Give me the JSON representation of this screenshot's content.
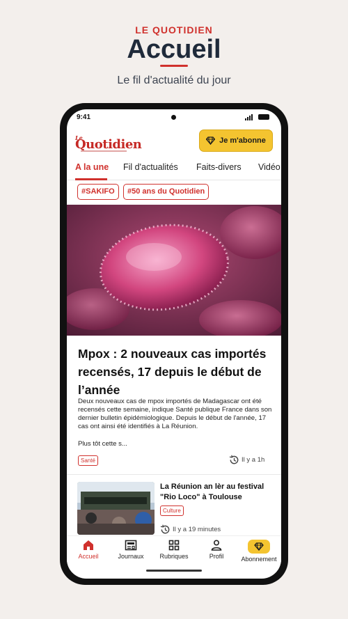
{
  "hero": {
    "brand": "LE QUOTIDIEN",
    "title": "Accueil",
    "subtitle": "Le fil d'actualité du jour"
  },
  "status_bar": {
    "time": "9:41"
  },
  "header": {
    "logo_small": "Le",
    "logo_main": "Quotidien",
    "subscribe_label": "Je m'abonne"
  },
  "tabs": [
    {
      "label": "A la une",
      "active": true
    },
    {
      "label": "Fil d'actualités"
    },
    {
      "label": "Faits-divers"
    },
    {
      "label": "Vidéo"
    }
  ],
  "tags": [
    "#SAKIFO",
    "#50 ans du Quotidien"
  ],
  "main_article": {
    "title": "Mpox : 2 nouveaux cas importés recensés, 17 depuis le début de l’année",
    "lead": "Deux nouveaux cas de mpox importés de Madagascar ont été recensés cette semaine, indique Santé publique France dans son dernier bulletin épidémiologique. Depuis le début de l'année, 17 cas ont ainsi été identifiés à La Réunion.",
    "more": "Plus tôt cette s...",
    "category": "Santé",
    "time": "Il y a 1h"
  },
  "second_article": {
    "title": "La Réunion an lèr au festival \"Rio Loco\" à Toulouse",
    "category": "Culture",
    "time": "Il y a 19 minutes"
  },
  "bottom_nav": [
    {
      "label": "Accueil",
      "icon": "home-icon",
      "active": true
    },
    {
      "label": "Journaux",
      "icon": "newspaper-icon"
    },
    {
      "label": "Rubriques",
      "icon": "grid-icon"
    },
    {
      "label": "Profil",
      "icon": "person-icon"
    },
    {
      "label": "Abonnement",
      "icon": "diamond-icon"
    }
  ],
  "colors": {
    "accent": "#d0312d",
    "subscribe": "#f4c430",
    "background": "#f3efec"
  }
}
